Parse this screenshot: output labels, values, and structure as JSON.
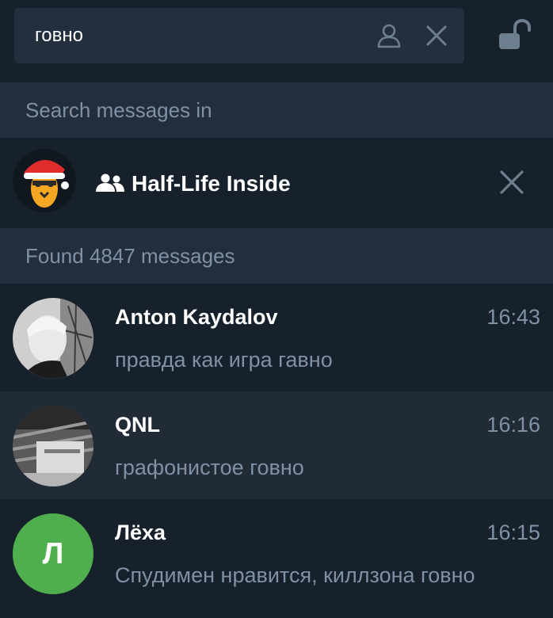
{
  "search": {
    "value": "говно",
    "user_filter_icon": "person-icon",
    "clear_icon": "close-icon"
  },
  "lock_icon": "unlock-icon",
  "search_in": {
    "header": "Search messages in",
    "chat": {
      "title": "Half-Life Inside",
      "type_icon": "group-icon",
      "remove_icon": "close-icon"
    }
  },
  "results": {
    "header": "Found 4847 messages",
    "items": [
      {
        "name": "Anton Kaydalov",
        "time": "16:43",
        "text": "правда как игра гавно"
      },
      {
        "name": "QNL",
        "time": "16:16",
        "text": "графонистое говно"
      },
      {
        "name": "Лёха",
        "time": "16:15",
        "text": "Спудимен нравится, киллзона говно",
        "initial": "Л"
      }
    ]
  },
  "colors": {
    "background": "#17212b",
    "section": "#232e3c",
    "input": "#242f3d",
    "muted_text": "#7f91a4",
    "avatar_green": "#4fae4e"
  }
}
